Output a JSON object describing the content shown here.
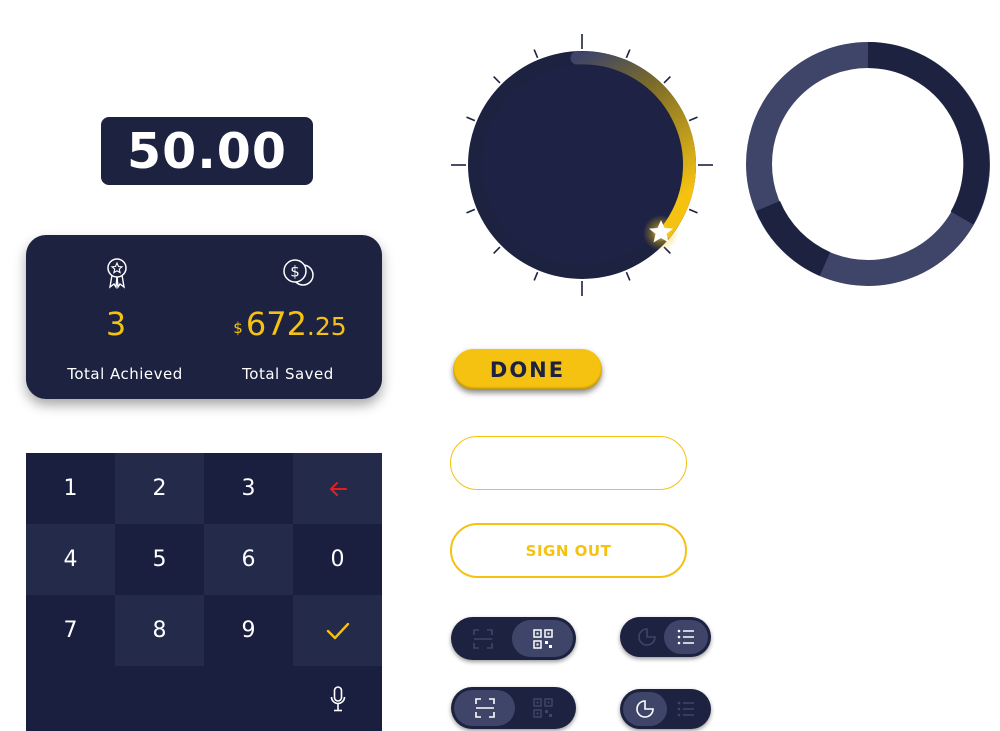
{
  "amount_display": {
    "value": "50.00"
  },
  "stats": {
    "achieved": {
      "icon": "award-ribbon-icon",
      "value": "3",
      "label": "Total Achieved"
    },
    "saved": {
      "icon": "coins-icon",
      "currency": "$",
      "whole": "672",
      "decimal": ".25",
      "label": "Total Saved"
    }
  },
  "keypad": {
    "keys": [
      "1",
      "2",
      "3",
      "4",
      "5",
      "6",
      "0",
      "7",
      "8",
      "9"
    ],
    "backspace_icon": "arrow-left-icon",
    "confirm_icon": "checkmark-icon",
    "mic_icon": "microphone-icon"
  },
  "dial": {
    "progress": 0.35,
    "handle_icon": "star-icon"
  },
  "ring": {
    "segments": "progress-ring"
  },
  "buttons": {
    "done": "DONE",
    "sign_out": "SIGN OUT"
  },
  "toggles": [
    {
      "name": "scan-qr-toggle",
      "left_icon": "scan-icon",
      "right_icon": "qr-code-icon",
      "selected": "right"
    },
    {
      "name": "chart-list-toggle",
      "left_icon": "pie-chart-icon",
      "right_icon": "list-icon",
      "selected": "right"
    },
    {
      "name": "scan-qr-toggle-2",
      "left_icon": "scan-icon",
      "right_icon": "qr-code-icon",
      "selected": "left"
    },
    {
      "name": "chart-list-toggle-2",
      "left_icon": "pie-chart-icon",
      "right_icon": "list-icon",
      "selected": "left"
    }
  ],
  "colors": {
    "navy": "#1c2240",
    "accent": "#f5c211",
    "muted": "#3e4568",
    "alert": "#e02020"
  }
}
